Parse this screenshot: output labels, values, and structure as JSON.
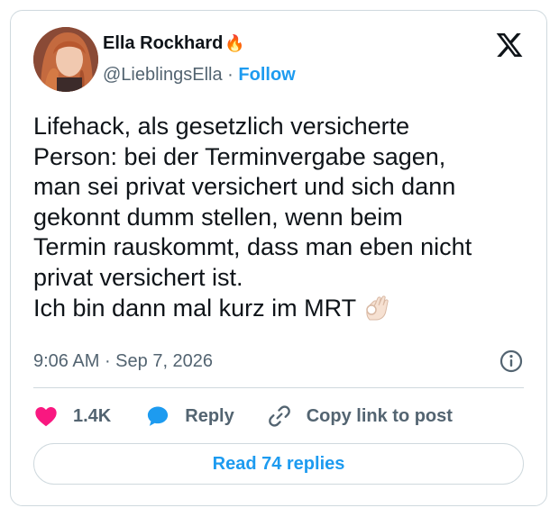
{
  "author": {
    "name": "Ella Rockhard",
    "name_emoji": "🔥",
    "handle": "@LieblingsElla",
    "separator": " · ",
    "follow_label": "Follow"
  },
  "post": {
    "lines": [
      "Lifehack, als gesetzlich versicherte",
      "Person: bei der Terminvergabe sagen,",
      "man sei privat versichert und sich dann",
      "gekonnt dumm stellen, wenn beim",
      "Termin rauskommt, dass man eben nicht",
      "privat versichert ist.",
      "Ich bin dann mal kurz im MRT"
    ],
    "time": "9:06 AM",
    "date_separator": " · ",
    "date": "Sep 7, 2026"
  },
  "actions": {
    "likes": "1.4K",
    "reply_label": "Reply",
    "copy_label": "Copy link to post"
  },
  "footer": {
    "read_replies_label": "Read 74 replies"
  },
  "colors": {
    "accent": "#1d9bf0",
    "like": "#f91880",
    "secondary_text": "#536471",
    "border": "#cfd9de"
  },
  "icons": [
    "x-logo-icon",
    "fire-emoji-icon",
    "ok-hand-emoji-icon",
    "info-icon",
    "heart-icon",
    "reply-bubble-icon",
    "link-icon"
  ]
}
